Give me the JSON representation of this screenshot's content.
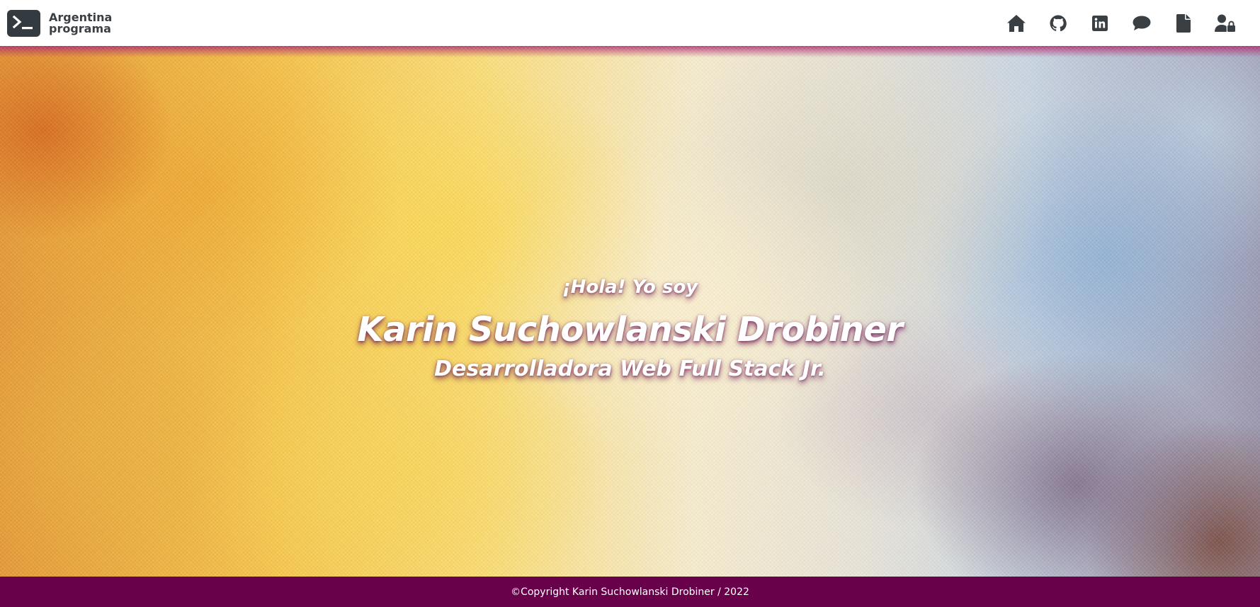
{
  "header": {
    "brand": {
      "logo_icon": "terminal-prompt-icon",
      "line1": "Argentina",
      "line2": "programa"
    },
    "nav": [
      {
        "icon": "home-icon"
      },
      {
        "icon": "github-icon"
      },
      {
        "icon": "linkedin-icon"
      },
      {
        "icon": "chat-bubble-icon"
      },
      {
        "icon": "file-document-icon"
      },
      {
        "icon": "user-lock-icon"
      }
    ]
  },
  "hero": {
    "greeting": "¡Hola! Yo soy",
    "name": "Karin Suchowlanski Drobiner",
    "role": "Desarrolladora Web Full Stack Jr."
  },
  "footer": {
    "copyright": "©Copyright Karin Suchowlanski Drobiner / 2022"
  },
  "colors": {
    "footer_bg": "#68004a",
    "icon": "#3a3f44",
    "logo_bg": "#333a40",
    "text_shadow": "#6e1450"
  }
}
